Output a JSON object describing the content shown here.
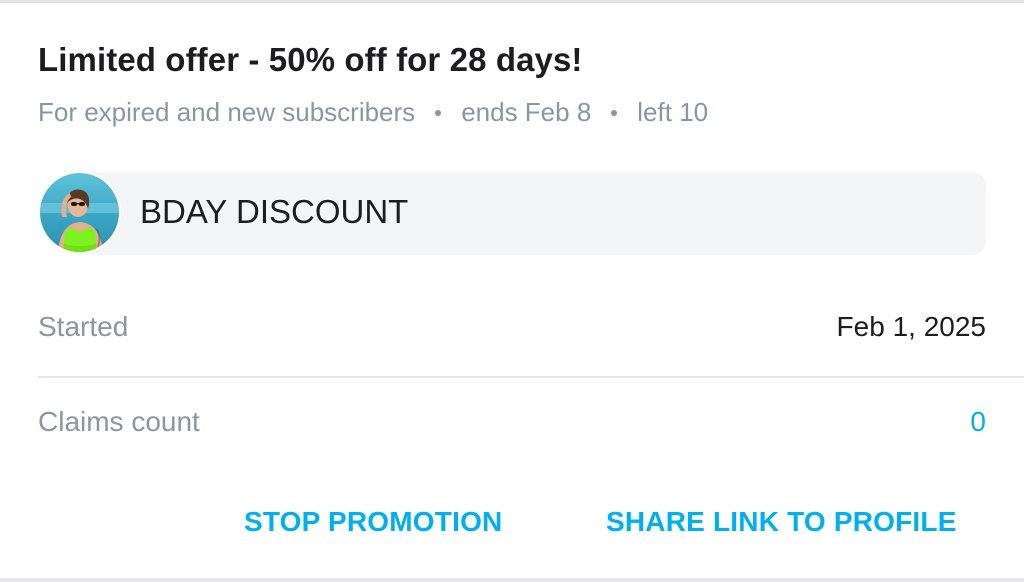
{
  "offer": {
    "title": "Limited offer - 50% off for 28 days!",
    "audience": "For expired and new subscribers",
    "ends": "ends Feb 8",
    "left": "left 10"
  },
  "promo": {
    "avatar_icon": "user-avatar-photo",
    "label": "BDAY DISCOUNT"
  },
  "details": {
    "started_label": "Started",
    "started_value": "Feb 1, 2025",
    "claims_label": "Claims count",
    "claims_value": "0"
  },
  "actions": {
    "stop_label": "STOP PROMOTION",
    "share_label": "SHARE LINK TO PROFILE"
  },
  "colors": {
    "accent": "#00aff0",
    "muted_text": "#8a96a3",
    "primary_text": "#1d1d1f",
    "chip_background": "#f4f5f7"
  }
}
